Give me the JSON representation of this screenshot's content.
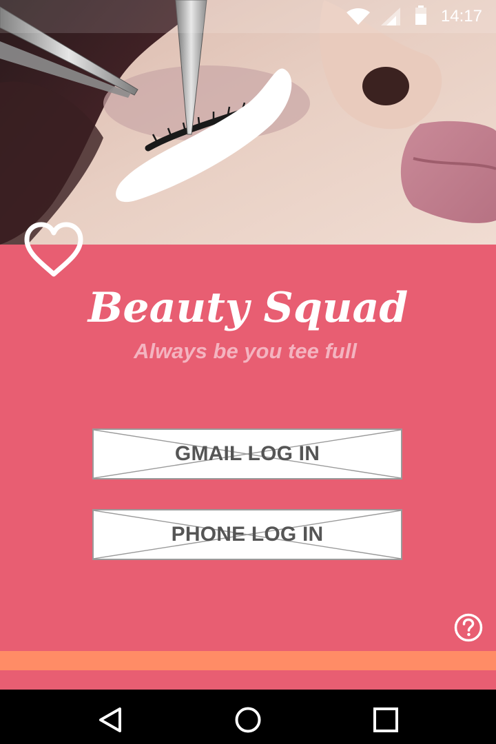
{
  "status_bar": {
    "time": "14:17",
    "icons": [
      "wifi-icon",
      "cell-signal-icon",
      "battery-icon"
    ]
  },
  "hero": {
    "image": "eyelash-extension-photo"
  },
  "app": {
    "title": "Beauty Squad",
    "tagline": "Always be you tee full",
    "logo_icon": "heart-outline-icon"
  },
  "login": {
    "gmail_label": "GMAIL LOG IN",
    "phone_label": "PHONE LOG IN"
  },
  "help": {
    "icon": "help-circle-icon"
  },
  "nav_bar": {
    "icons": [
      "back-triangle-icon",
      "home-circle-icon",
      "recents-square-icon"
    ]
  },
  "colors": {
    "panel_pink": "#e85e72",
    "accent_orange": "#ff8c66",
    "tagline_pink": "#f4b4c0",
    "button_text": "#555555"
  }
}
